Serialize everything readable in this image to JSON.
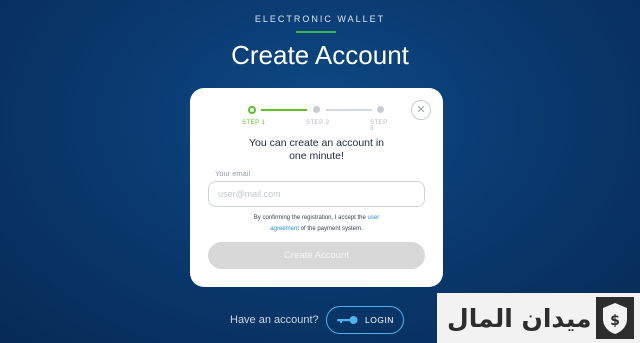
{
  "header": {
    "overline": "ELECTRONIC WALLET",
    "title": "Create Account"
  },
  "stepper": {
    "steps": [
      {
        "label": "STEP 1",
        "state": "active"
      },
      {
        "label": "STEP 2",
        "state": "inactive"
      },
      {
        "label": "STEP 3",
        "state": "inactive"
      }
    ]
  },
  "card": {
    "heading_line1": "You can create an account in",
    "heading_line2": "one minute!",
    "email_label": "Your email",
    "email_placeholder": "user@mail.com",
    "email_value": "",
    "agreement_prefix": "By confirming the registration, I accept the ",
    "agreement_link1": "user",
    "agreement_link2": "agreement",
    "agreement_suffix": " of the payment system.",
    "submit_label": "Create Account",
    "close_icon": "close-icon"
  },
  "footer": {
    "have_account": "Have an account?",
    "login_label": "LOGIN",
    "login_icon": "key-icon"
  },
  "watermark": {
    "text": "ميدان المال"
  },
  "colors": {
    "accent_green": "#5fbf2a",
    "link_blue": "#2a8fd6",
    "login_border": "#4fb3ea",
    "background": "#0a3a70"
  }
}
